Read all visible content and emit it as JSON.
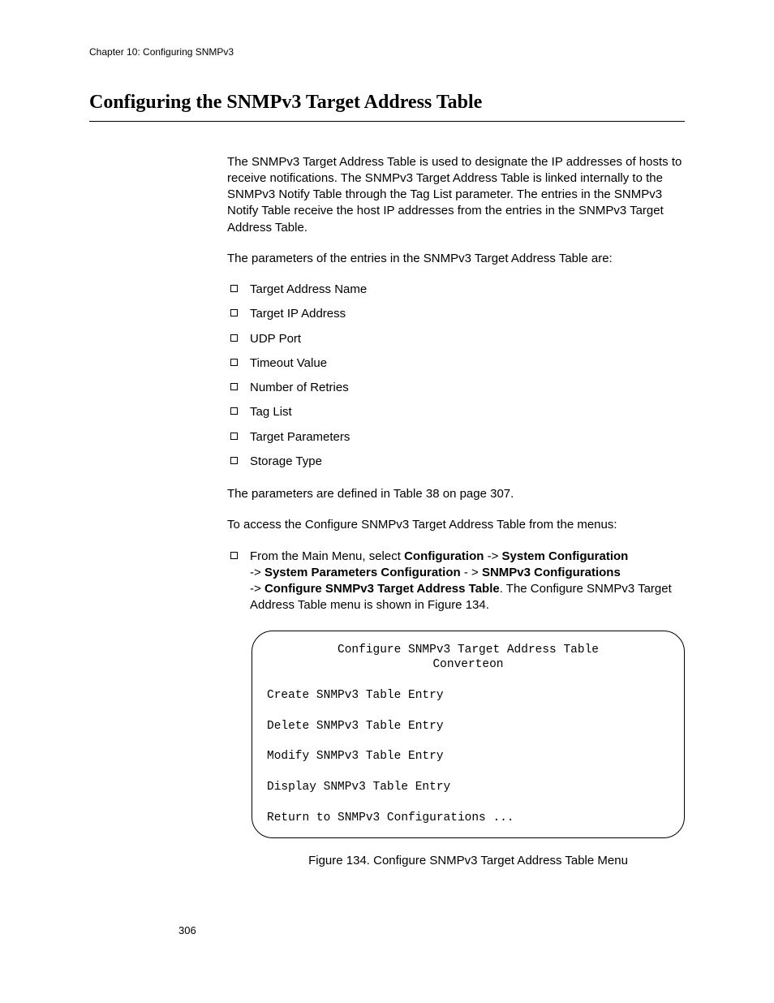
{
  "header": {
    "chapter": "Chapter 10: Configuring SNMPv3"
  },
  "title": "Configuring the SNMPv3 Target Address Table",
  "intro_para": "The SNMPv3 Target Address Table is used to designate the IP addresses of hosts to receive notifications. The SNMPv3 Target Address Table is linked internally to the SNMPv3 Notify Table through the Tag List parameter. The entries in the SNMPv3 Notify Table receive the host IP addresses from the entries in the SNMPv3 Target Address Table.",
  "params_intro": "The parameters of the entries in the SNMPv3 Target Address Table are:",
  "param_bullets": [
    "Target Address Name",
    "Target IP Address",
    "UDP Port",
    "Timeout Value",
    "Number of Retries",
    "Tag List",
    "Target Parameters",
    "Storage Type"
  ],
  "params_defined": "The parameters are defined in Table 38 on page 307.",
  "access_line": "To access the Configure SNMPv3 Target Address Table from the menus:",
  "nav": {
    "lead": "From the Main Menu, select ",
    "s1": "Configuration",
    "arrow": " -> ",
    "s2": "System Configuration",
    "line2_arrow": "-> ",
    "s3": "System Parameters Configuration",
    "mid": " - > ",
    "s4": "SNMPv3 Configurations",
    "line3_arrow": "-> ",
    "s5": "Configure SNMPv3 Target Address Table",
    "tail": ". The Configure SNMPv3 Target Address Table menu is shown in Figure 134."
  },
  "menu": {
    "title1": "Configure SNMPv3 Target Address Table",
    "title2": "Converteon",
    "items": [
      "Create SNMPv3 Table Entry",
      "Delete SNMPv3 Table Entry",
      "Modify SNMPv3 Table Entry",
      "Display SNMPv3 Table Entry",
      "Return to SNMPv3 Configurations ..."
    ]
  },
  "figure_caption": "Figure 134. Configure SNMPv3 Target Address Table Menu",
  "page_number": "306"
}
